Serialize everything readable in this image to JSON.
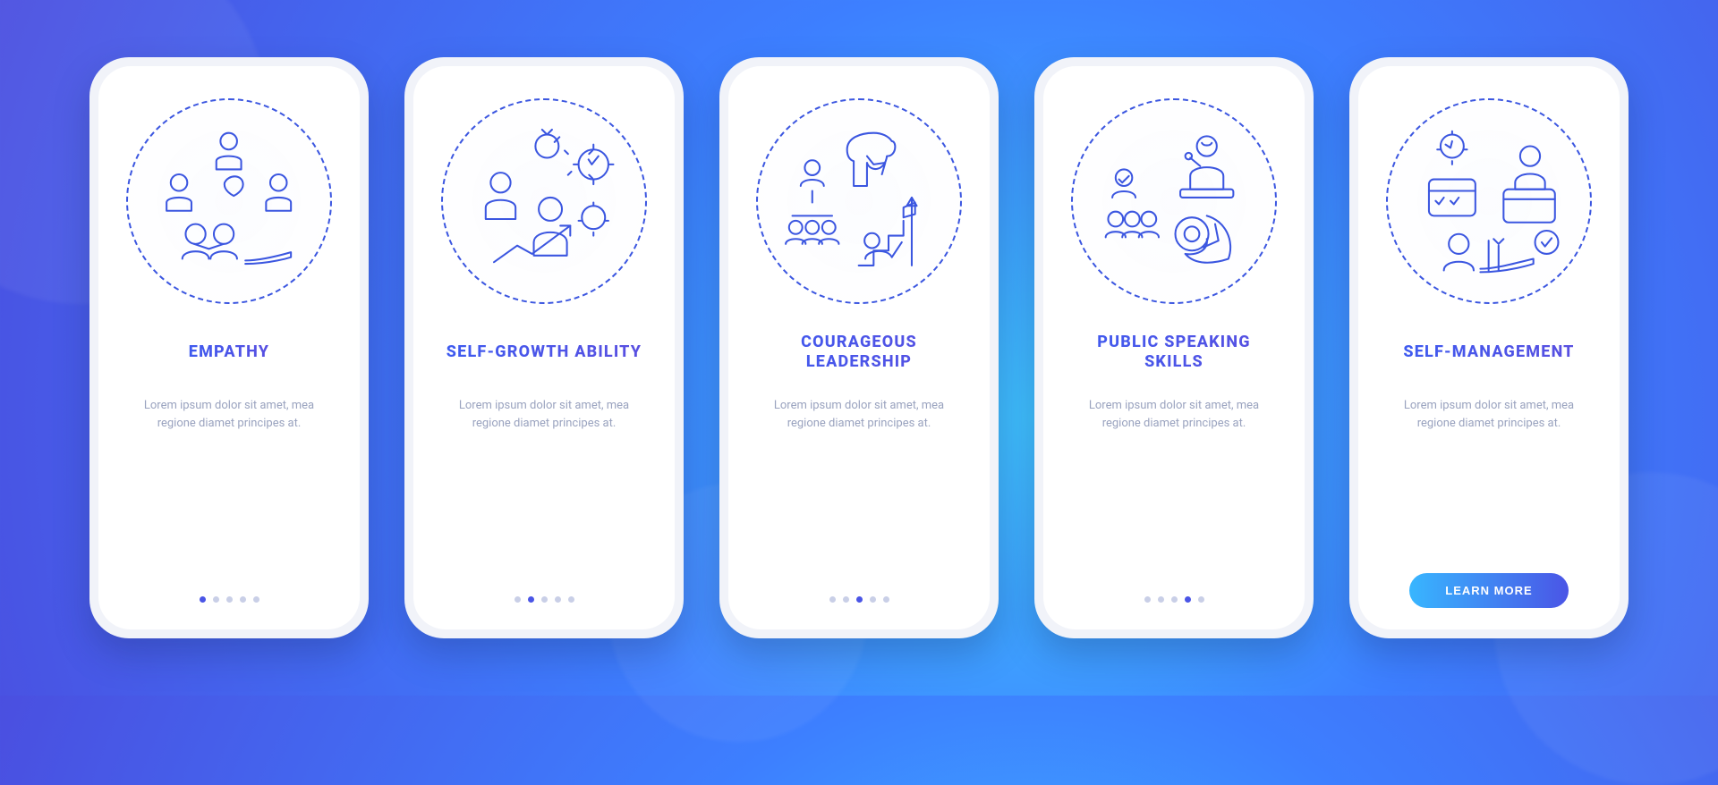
{
  "lorem": "Lorem ipsum dolor sit amet, mea regione diamet principes at.",
  "cta_label": "LEARN MORE",
  "slides": [
    {
      "title": "EMPATHY",
      "icon": "empathy-icon"
    },
    {
      "title": "SELF-GROWTH ABILITY",
      "icon": "self-growth-icon"
    },
    {
      "title": "COURAGEOUS LEADERSHIP",
      "icon": "leadership-icon"
    },
    {
      "title": "PUBLIC SPEAKING SKILLS",
      "icon": "public-speaking-icon"
    },
    {
      "title": "SELF-MANAGEMENT",
      "icon": "self-management-icon"
    }
  ],
  "colors": {
    "accent": "#4a55e6",
    "secondary": "#38b6ff",
    "text_muted": "#9aa3bf"
  }
}
